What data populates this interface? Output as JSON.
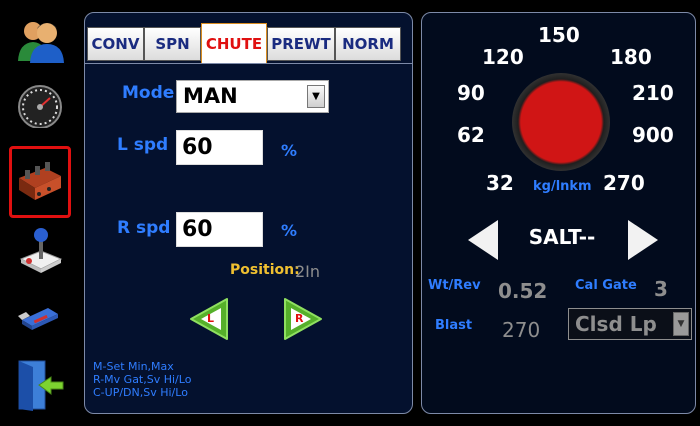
{
  "sidebar": {
    "items": [
      {
        "name": "user-icon",
        "selected": false
      },
      {
        "name": "speedometer-icon",
        "selected": false
      },
      {
        "name": "valve-block-icon",
        "selected": true
      },
      {
        "name": "joystick-icon",
        "selected": false
      },
      {
        "name": "usb-drive-icon",
        "selected": false
      },
      {
        "name": "exit-door-icon",
        "selected": false
      }
    ]
  },
  "tabs": [
    {
      "label": "CONV",
      "active": false
    },
    {
      "label": "SPN",
      "active": false
    },
    {
      "label": "CHUTE",
      "active": true
    },
    {
      "label": "PREWT",
      "active": false
    },
    {
      "label": "NORM",
      "active": false
    }
  ],
  "chute": {
    "mode_label": "Mode",
    "mode_value": "MAN",
    "l_spd_label": "L spd",
    "l_spd_value": "60",
    "l_spd_unit": "%",
    "r_spd_label": "R spd",
    "r_spd_value": "60",
    "r_spd_unit": "%",
    "position_label": "Position:",
    "position_value": "2In",
    "left_button_label": "L",
    "right_button_label": "R",
    "help_lines": [
      "M-Set Min,Max",
      "R-Mv Gat,Sv Hi/Lo",
      "C-UP/DN,Sv Hi/Lo"
    ]
  },
  "dial": {
    "labels": [
      "150",
      "120",
      "180",
      "90",
      "210",
      "62",
      "900",
      "32",
      "270"
    ],
    "unit": "kg/lnkm",
    "knob_color": "#d01515"
  },
  "material": {
    "name": "SALT--",
    "wt_rev_label": "Wt/Rev",
    "wt_rev_value": "0.52",
    "cal_gate_label": "Cal Gate",
    "cal_gate_value": "3",
    "blast_label": "Blast",
    "blast_value": "270",
    "blast_mode": "Clsd Lp"
  },
  "colors": {
    "accent_blue": "#2f7dff",
    "active_tab_text": "#e01010",
    "position_label": "#f0c030",
    "selected_outline": "#e01010"
  }
}
